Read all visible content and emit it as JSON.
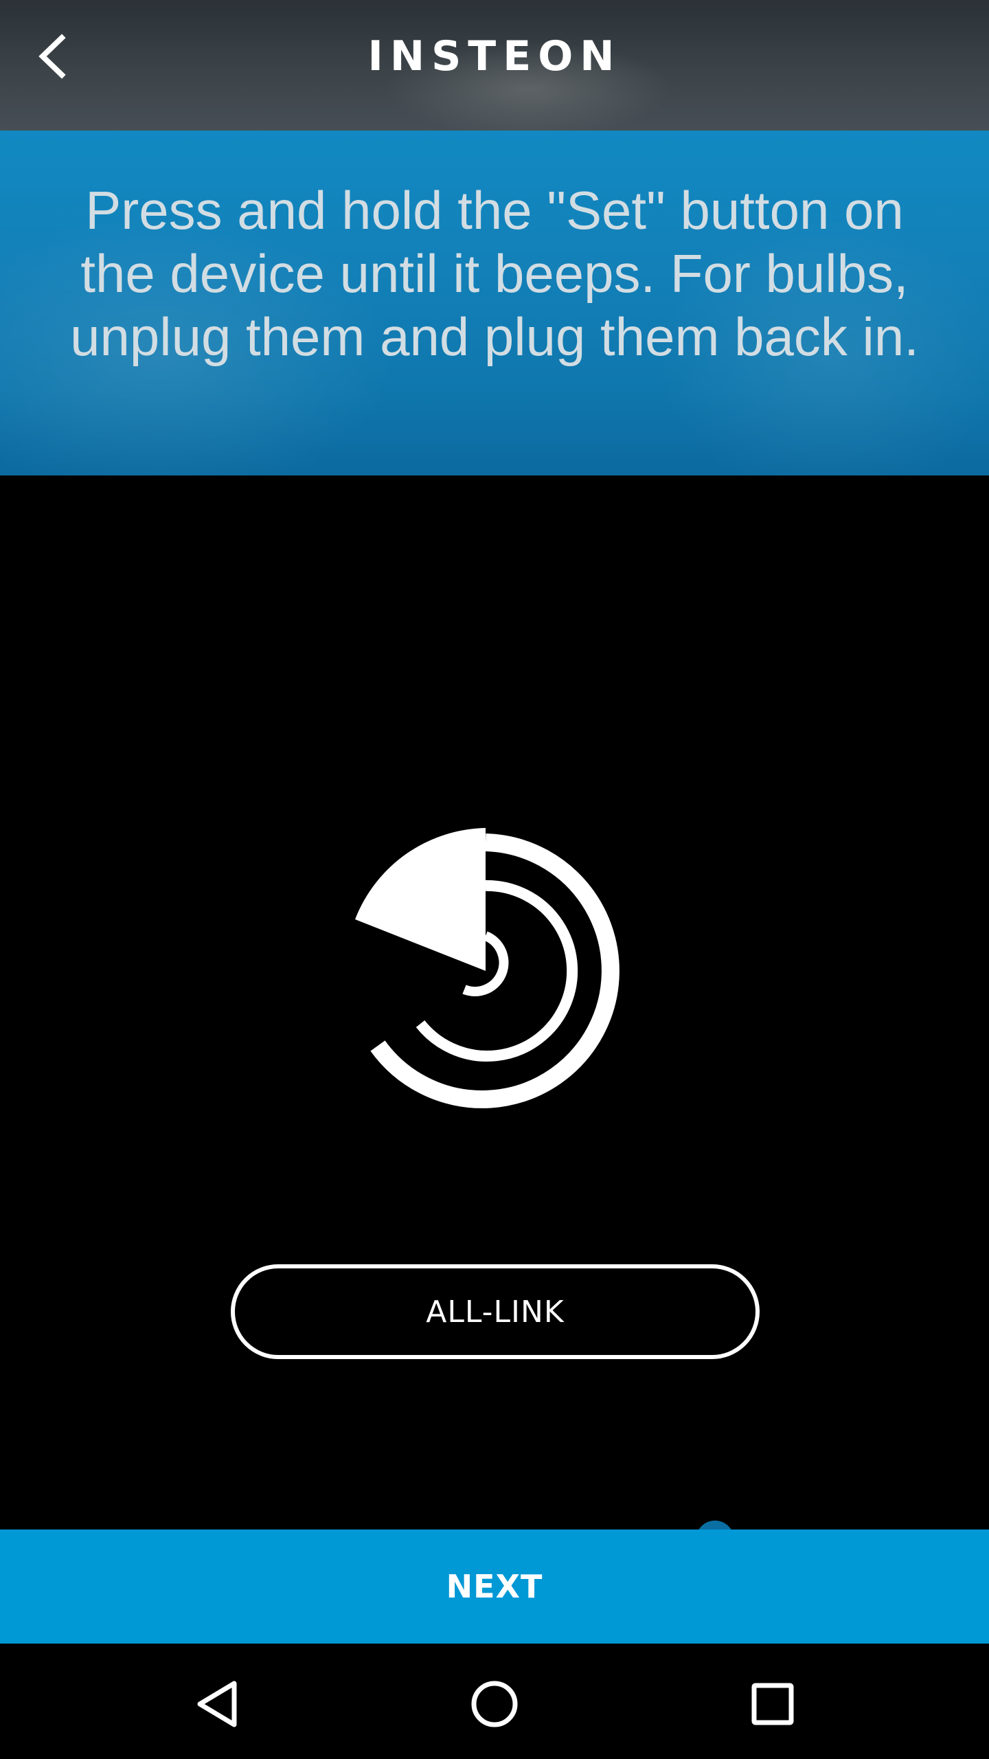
{
  "header": {
    "title": "INSTEON",
    "back_icon": "chevron-left-icon"
  },
  "banner": {
    "instruction": "Press and hold the \"Set\" button on the device until it beeps. For bulbs, unplug them and plug them back in."
  },
  "main": {
    "icon": "all-link-radar-icon",
    "all_link_label": "ALL-LINK"
  },
  "footer": {
    "next_label": "NEXT"
  },
  "system_nav": {
    "back_icon": "nav-back-icon",
    "home_icon": "nav-home-icon",
    "recents_icon": "nav-recents-icon"
  },
  "colors": {
    "accent": "#0198d6",
    "banner": "#1380b8",
    "background": "#000000",
    "text": "#ffffff"
  }
}
